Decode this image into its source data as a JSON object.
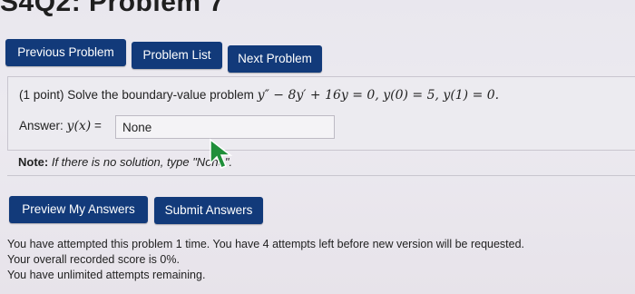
{
  "page": {
    "title": "S4Q2: Problem 7"
  },
  "nav": {
    "previous_label": "Previous Problem",
    "list_label": "Problem List",
    "next_label": "Next Problem"
  },
  "problem": {
    "prefix": "(1 point) Solve the boundary-value problem",
    "equation": "y″ − 8y′ + 16y = 0,  y(0) = 5,  y(1) = 0.",
    "answer_label": "Answer: ",
    "answer_var": "y(x)",
    "answer_equals": " = ",
    "answer_value": "None"
  },
  "note": {
    "label": "Note:",
    "text": " If there is no solution, type \"None\"."
  },
  "actions": {
    "preview_label": "Preview My Answers",
    "submit_label": "Submit Answers"
  },
  "status": {
    "attempts": "You have attempted this problem 1 time. You have 4 attempts left before new version will be requested.",
    "score": "Your overall recorded score is 0%.",
    "remaining": "You have unlimited attempts remaining."
  },
  "colors": {
    "button": "#123a7a",
    "button_text": "#ffffff"
  }
}
